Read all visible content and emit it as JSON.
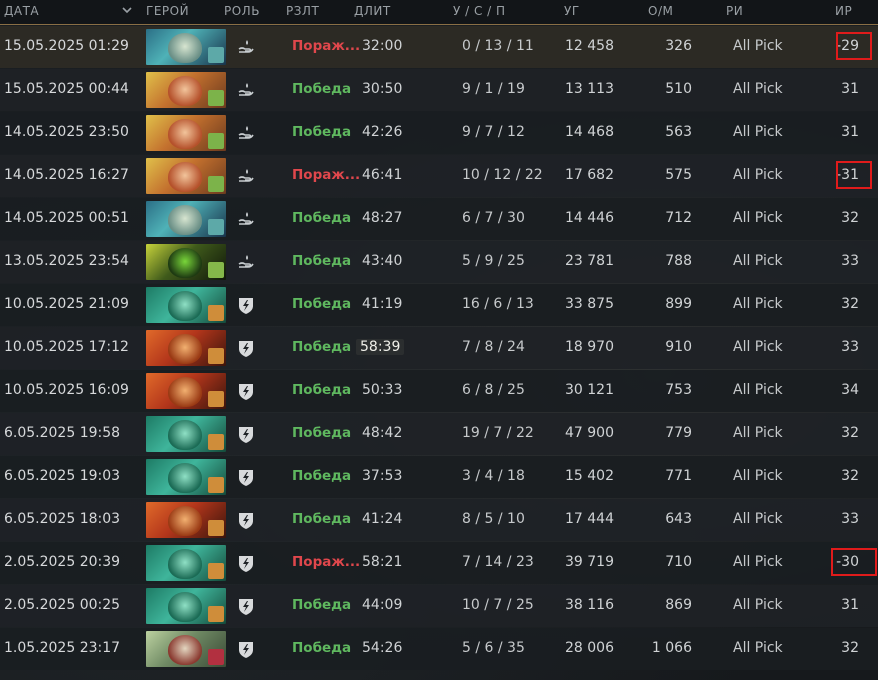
{
  "header": {
    "date": "ДАТА",
    "hero": "ГЕРОЙ",
    "role": "РОЛЬ",
    "result": "РЗЛТ",
    "duration": "ДЛИТ",
    "kda": "У / С / П",
    "networth": "УГ",
    "gpm": "О/М",
    "mode": "РИ",
    "mmr": "ИР"
  },
  "colors": {
    "win": "#5fb85f",
    "loss": "#e0474c",
    "highlight_box": "#e01b1b",
    "header_border": "#8a6f45"
  },
  "matches": [
    {
      "date": "15.05.2025 01:29",
      "hero": "hero-portrait-muerta",
      "role": "support-icon",
      "result": "Пораж...",
      "outcome": "loss",
      "duration": "32:00",
      "kda": "0 / 13 / 11",
      "networth": "12 458",
      "gpm": "326",
      "mode": "All Pick",
      "mmr": "-29",
      "highlighted": true
    },
    {
      "date": "15.05.2025 00:44",
      "hero": "hero-portrait-lina",
      "role": "support-icon",
      "result": "Победа",
      "outcome": "win",
      "duration": "30:50",
      "kda": "9 / 1 / 19",
      "networth": "13 113",
      "gpm": "510",
      "mode": "All Pick",
      "mmr": "31",
      "highlighted": false
    },
    {
      "date": "14.05.2025 23:50",
      "hero": "hero-portrait-lina",
      "role": "support-icon",
      "result": "Победа",
      "outcome": "win",
      "duration": "42:26",
      "kda": "9 / 7 / 12",
      "networth": "14 468",
      "gpm": "563",
      "mode": "All Pick",
      "mmr": "31",
      "highlighted": false
    },
    {
      "date": "14.05.2025 16:27",
      "hero": "hero-portrait-lina",
      "role": "support-icon",
      "result": "Пораж...",
      "outcome": "loss",
      "duration": "46:41",
      "kda": "10 / 12 / 22",
      "networth": "17 682",
      "gpm": "575",
      "mode": "All Pick",
      "mmr": "-31",
      "highlighted": true
    },
    {
      "date": "14.05.2025 00:51",
      "hero": "hero-portrait-muerta",
      "role": "support-icon",
      "result": "Победа",
      "outcome": "win",
      "duration": "48:27",
      "kda": "6 / 7 / 30",
      "networth": "14 446",
      "gpm": "712",
      "mode": "All Pick",
      "mmr": "32",
      "highlighted": false
    },
    {
      "date": "13.05.2025 23:54",
      "hero": "hero-portrait-necrophos",
      "role": "support-icon",
      "result": "Победа",
      "outcome": "win",
      "duration": "43:40",
      "kda": "5 / 9 / 25",
      "networth": "23 781",
      "gpm": "788",
      "mode": "All Pick",
      "mmr": "33",
      "highlighted": false
    },
    {
      "date": "10.05.2025 21:09",
      "hero": "hero-portrait-earthshaker",
      "role": "carry-icon",
      "result": "Победа",
      "outcome": "win",
      "duration": "41:19",
      "kda": "16 / 6 / 13",
      "networth": "33 875",
      "gpm": "899",
      "mode": "All Pick",
      "mmr": "32",
      "highlighted": false
    },
    {
      "date": "10.05.2025 17:12",
      "hero": "hero-portrait-brewmaster",
      "role": "carry-icon",
      "result": "Победа",
      "outcome": "win",
      "duration": "58:39",
      "kda": "7 / 8 / 24",
      "networth": "18 970",
      "gpm": "910",
      "mode": "All Pick",
      "mmr": "33",
      "highlighted": false,
      "duration_hl": true
    },
    {
      "date": "10.05.2025 16:09",
      "hero": "hero-portrait-brewmaster",
      "role": "carry-icon",
      "result": "Победа",
      "outcome": "win",
      "duration": "50:33",
      "kda": "6 / 8 / 25",
      "networth": "30 121",
      "gpm": "753",
      "mode": "All Pick",
      "mmr": "34",
      "highlighted": false
    },
    {
      "date": "6.05.2025 19:58",
      "hero": "hero-portrait-earthshaker",
      "role": "carry-icon",
      "result": "Победа",
      "outcome": "win",
      "duration": "48:42",
      "kda": "19 / 7 / 22",
      "networth": "47 900",
      "gpm": "779",
      "mode": "All Pick",
      "mmr": "32",
      "highlighted": false
    },
    {
      "date": "6.05.2025 19:03",
      "hero": "hero-portrait-earthshaker",
      "role": "carry-icon",
      "result": "Победа",
      "outcome": "win",
      "duration": "37:53",
      "kda": "3 / 4 / 18",
      "networth": "15 402",
      "gpm": "771",
      "mode": "All Pick",
      "mmr": "32",
      "highlighted": false
    },
    {
      "date": "6.05.2025 18:03",
      "hero": "hero-portrait-brewmaster",
      "role": "carry-icon",
      "result": "Победа",
      "outcome": "win",
      "duration": "41:24",
      "kda": "8 / 5 / 10",
      "networth": "17 444",
      "gpm": "643",
      "mode": "All Pick",
      "mmr": "33",
      "highlighted": false
    },
    {
      "date": "2.05.2025 20:39",
      "hero": "hero-portrait-earthshaker",
      "role": "carry-icon",
      "result": "Пораж...",
      "outcome": "loss",
      "duration": "58:21",
      "kda": "7 / 14 / 23",
      "networth": "39 719",
      "gpm": "710",
      "mode": "All Pick",
      "mmr": "-30",
      "highlighted": true,
      "wide": true
    },
    {
      "date": "2.05.2025 00:25",
      "hero": "hero-portrait-earthshaker",
      "role": "carry-icon",
      "result": "Победа",
      "outcome": "win",
      "duration": "44:09",
      "kda": "10 / 7 / 25",
      "networth": "38 116",
      "gpm": "869",
      "mode": "All Pick",
      "mmr": "31",
      "highlighted": false
    },
    {
      "date": "1.05.2025 23:17",
      "hero": "hero-portrait-pudge",
      "role": "carry-icon",
      "result": "Победа",
      "outcome": "win",
      "duration": "54:26",
      "kda": "5 / 6 / 35",
      "networth": "28 006",
      "gpm": "1 066",
      "mode": "All Pick",
      "mmr": "32",
      "highlighted": false
    }
  ]
}
